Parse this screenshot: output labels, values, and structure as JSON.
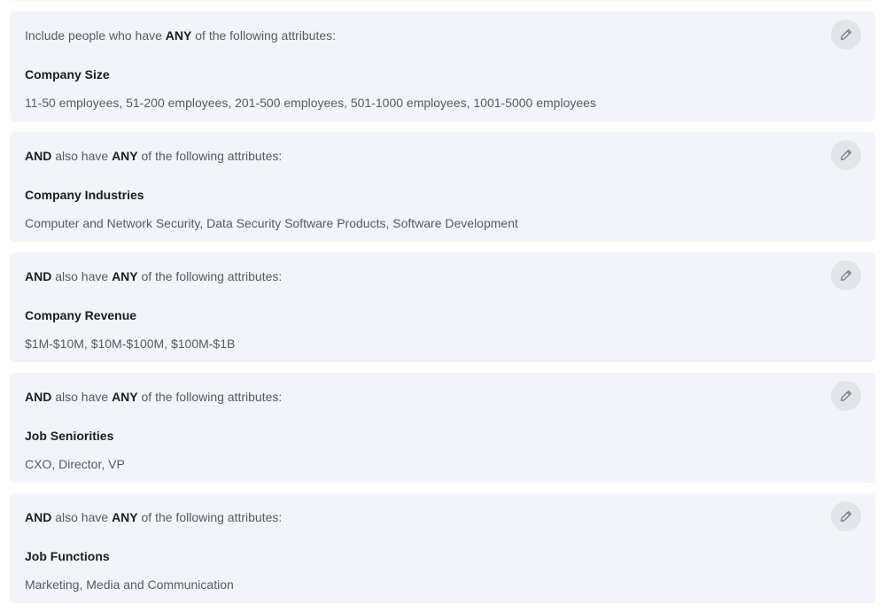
{
  "rules": [
    {
      "prefix_plain": "Include people who have ",
      "prefix_bold": "",
      "mid_plain": "",
      "quantifier": "ANY",
      "suffix": " of the following attributes:",
      "title": "Company Size",
      "values": "11-50 employees, 51-200 employees, 201-500 employees, 501-1000 employees, 1001-5000 employees",
      "edit_icon": "pencil-icon"
    },
    {
      "prefix_plain": "",
      "prefix_bold": "AND",
      "mid_plain": " also have ",
      "quantifier": "ANY",
      "suffix": " of the following attributes:",
      "title": "Company Industries",
      "values": "Computer and Network Security, Data Security Software Products, Software Development",
      "edit_icon": "pencil-icon"
    },
    {
      "prefix_plain": "",
      "prefix_bold": "AND",
      "mid_plain": " also have ",
      "quantifier": "ANY",
      "suffix": " of the following attributes:",
      "title": "Company Revenue",
      "values": "$1M-$10M, $10M-$100M, $100M-$1B",
      "edit_icon": "pencil-icon"
    },
    {
      "prefix_plain": "",
      "prefix_bold": "AND",
      "mid_plain": " also have ",
      "quantifier": "ANY",
      "suffix": " of the following attributes:",
      "title": "Job Seniorities",
      "values": "CXO, Director, VP",
      "edit_icon": "pencil-icon"
    },
    {
      "prefix_plain": "",
      "prefix_bold": "AND",
      "mid_plain": " also have ",
      "quantifier": "ANY",
      "suffix": " of the following attributes:",
      "title": "Job Functions",
      "values": "Marketing, Media and Communication",
      "edit_icon": "pencil-icon"
    }
  ],
  "colors": {
    "card_background": "#f1f4f8",
    "edit_button_background": "#e1e4e8",
    "text_primary": "#1a1d21",
    "text_secondary": "#555b63"
  }
}
